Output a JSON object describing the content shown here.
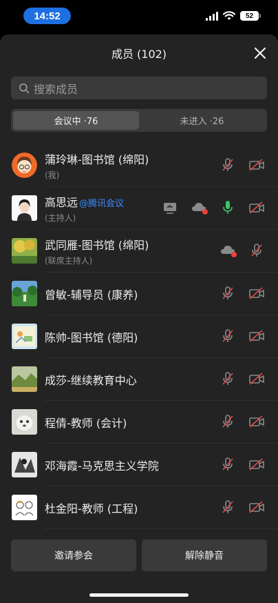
{
  "status_bar": {
    "time": "14:52",
    "battery": "52"
  },
  "sheet": {
    "title": "成员 (102)"
  },
  "search": {
    "placeholder": "搜索成员"
  },
  "tabs": [
    {
      "label": "会议中 ·76",
      "active": true
    },
    {
      "label": "未进入 ·26",
      "active": false
    }
  ],
  "members": [
    {
      "name": "蒲玲琳-图书馆 (绵阳)",
      "tag": "",
      "role": "(我)",
      "icons": [
        "mic-muted-icon",
        "camera-off-icon"
      ]
    },
    {
      "name": "高思远",
      "tag": "@腾讯会议",
      "role": "(主持人)",
      "icons": [
        "screen-share-icon",
        "cloud-record-icon",
        "mic-on-icon",
        "camera-off-icon"
      ]
    },
    {
      "name": "武同雁-图书馆 (绵阳)",
      "tag": "",
      "role": "(联席主持人)",
      "icons": [
        "cloud-record-icon",
        "mic-muted-icon"
      ]
    },
    {
      "name": "曾敏-辅导员 (康养)",
      "tag": "",
      "role": "",
      "icons": [
        "mic-muted-icon",
        "camera-off-icon"
      ]
    },
    {
      "name": "陈帅-图书馆 (德阳)",
      "tag": "",
      "role": "",
      "icons": [
        "mic-muted-icon",
        "camera-off-icon"
      ]
    },
    {
      "name": "成莎-继续教育中心",
      "tag": "",
      "role": "",
      "icons": [
        "mic-muted-icon",
        "camera-off-icon"
      ]
    },
    {
      "name": "程倩-教师 (会计)",
      "tag": "",
      "role": "",
      "icons": [
        "mic-muted-icon",
        "camera-off-icon"
      ]
    },
    {
      "name": "邓海霞-马克思主义学院",
      "tag": "",
      "role": "",
      "icons": [
        "mic-muted-icon",
        "camera-off-icon"
      ]
    },
    {
      "name": "杜金阳-教师 (工程)",
      "tag": "",
      "role": "",
      "icons": [
        "mic-muted-icon",
        "camera-off-icon"
      ]
    }
  ],
  "buttons": {
    "invite": "邀请参会",
    "unmute_all": "解除静音"
  },
  "colors": {
    "accent": "#1e6fe0",
    "tag_blue": "#3d8bff",
    "mic_green": "#3cc46a",
    "record_red": "#ef3f3f"
  }
}
